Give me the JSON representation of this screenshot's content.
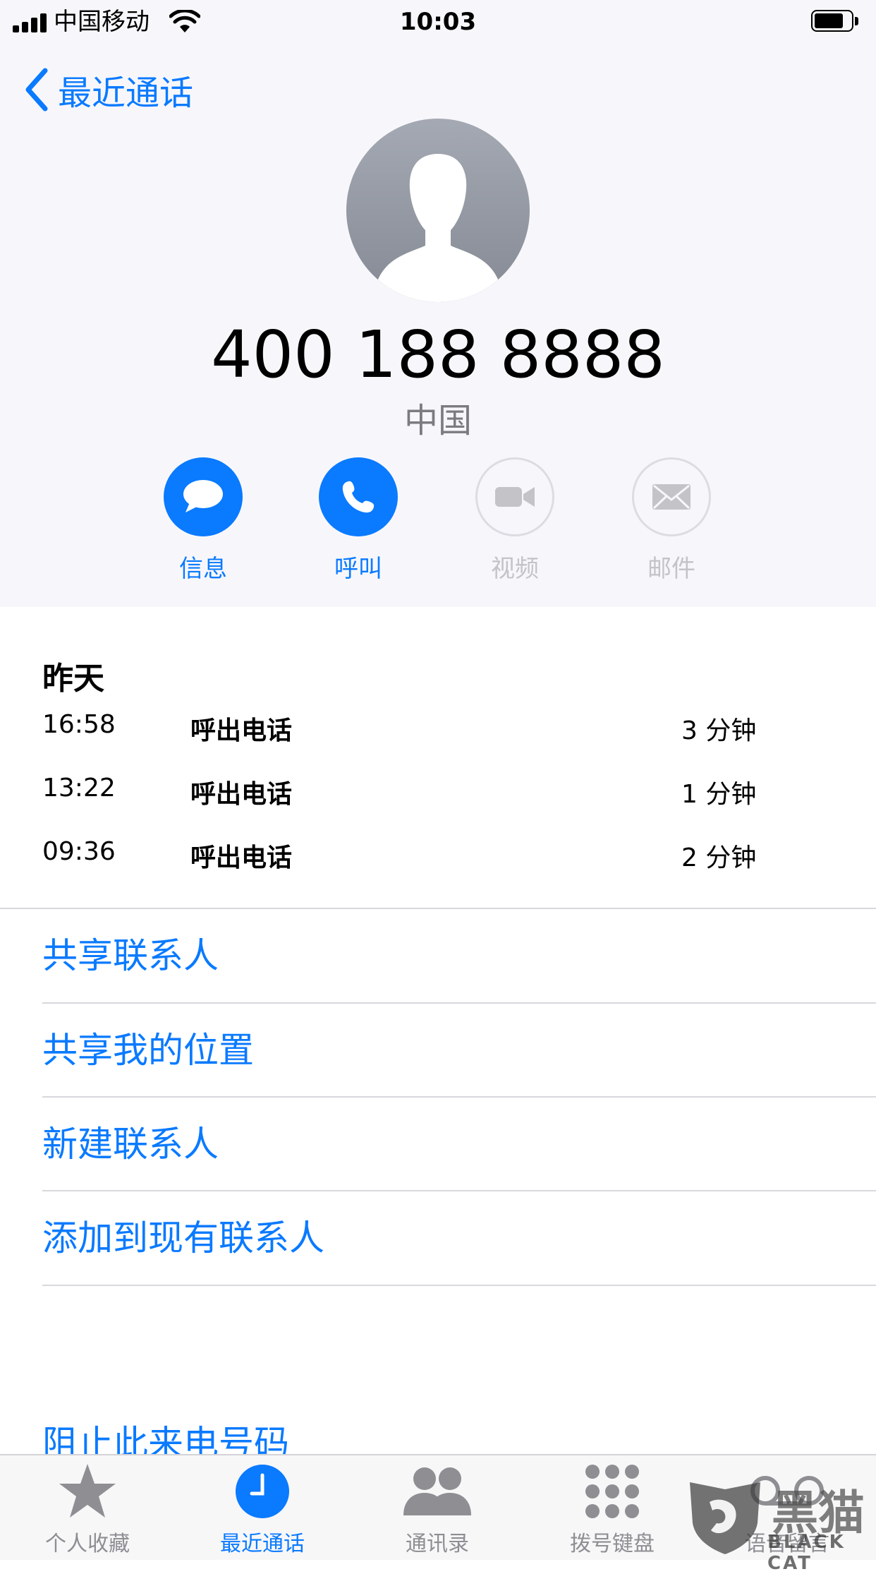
{
  "status_bar": {
    "carrier": "中国移动",
    "time": "10:03"
  },
  "nav": {
    "back_label": "最近通话"
  },
  "contact": {
    "number": "400 188 8888",
    "region": "中国"
  },
  "actions": [
    {
      "label": "信息",
      "icon": "message-icon",
      "enabled": true
    },
    {
      "label": "呼叫",
      "icon": "phone-icon",
      "enabled": true
    },
    {
      "label": "视频",
      "icon": "video-icon",
      "enabled": false
    },
    {
      "label": "邮件",
      "icon": "mail-icon",
      "enabled": false
    }
  ],
  "calls": {
    "date_header": "昨天",
    "rows": [
      {
        "time": "16:58",
        "type": "呼出电话",
        "duration": "3 分钟"
      },
      {
        "time": "13:22",
        "type": "呼出电话",
        "duration": "1 分钟"
      },
      {
        "time": "09:36",
        "type": "呼出电话",
        "duration": "2 分钟"
      }
    ]
  },
  "options": [
    "共享联系人",
    "共享我的位置",
    "新建联系人",
    "添加到现有联系人"
  ],
  "block_label": "阻止此来电号码",
  "tabs": [
    {
      "label": "个人收藏",
      "icon": "star-icon",
      "active": false
    },
    {
      "label": "最近通话",
      "icon": "clock-icon",
      "active": true
    },
    {
      "label": "通讯录",
      "icon": "contacts-icon",
      "active": false
    },
    {
      "label": "拨号键盘",
      "icon": "keypad-icon",
      "active": false
    },
    {
      "label": "语音留言",
      "icon": "voicemail-icon",
      "active": false
    }
  ],
  "watermark": {
    "text": "黑猫",
    "sub": "BLACK CAT"
  },
  "colors": {
    "accent": "#0a7aff",
    "header_bg": "#f7f7fb",
    "disabled": "#c3c3c8",
    "secondary_text": "#7b7b80"
  }
}
